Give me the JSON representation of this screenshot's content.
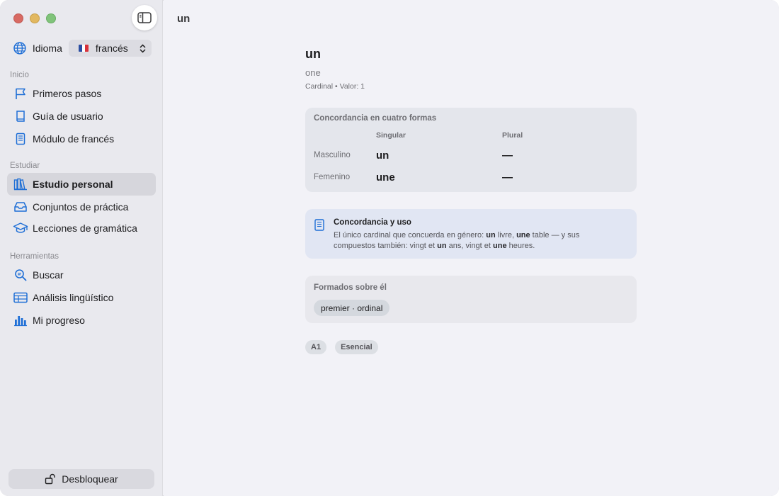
{
  "toolbar": {
    "title": "un"
  },
  "sidebar": {
    "language_label": "Idioma",
    "language_value": "francés",
    "sections": [
      {
        "title": "Inicio",
        "items": [
          {
            "label": "Primeros pasos",
            "icon": "flag-icon"
          },
          {
            "label": "Guía de usuario",
            "icon": "book-icon"
          },
          {
            "label": "Módulo de francés",
            "icon": "document-icon"
          }
        ]
      },
      {
        "title": "Estudiar",
        "items": [
          {
            "label": "Estudio personal",
            "icon": "books-icon",
            "active": true
          },
          {
            "label": "Conjuntos de práctica",
            "icon": "tray-icon"
          },
          {
            "label": "Lecciones de gramática",
            "icon": "graduation-cap-icon"
          }
        ]
      },
      {
        "title": "Herramientas",
        "items": [
          {
            "label": "Buscar",
            "icon": "search-icon"
          },
          {
            "label": "Análisis lingüístico",
            "icon": "table-icon"
          },
          {
            "label": "Mi progreso",
            "icon": "bar-chart-icon"
          }
        ]
      }
    ],
    "unlock_label": "Desbloquear"
  },
  "entry": {
    "word": "un",
    "translation": "one",
    "meta": "Cardinal • Valor: 1",
    "agreement": {
      "title": "Concordancia en cuatro formas",
      "columns": [
        "Singular",
        "Plural"
      ],
      "rows": [
        {
          "label": "Masculino",
          "singular": "un",
          "plural": "—"
        },
        {
          "label": "Femenino",
          "singular": "une",
          "plural": "—"
        }
      ]
    },
    "note": {
      "title": "Concordancia y uso",
      "body_parts": [
        {
          "t": "El único cardinal que concuerda en género: ",
          "b": false
        },
        {
          "t": "un",
          "b": true
        },
        {
          "t": " livre, ",
          "b": false
        },
        {
          "t": "une",
          "b": true
        },
        {
          "t": " table — y sus compuestos también: vingt et ",
          "b": false
        },
        {
          "t": "un",
          "b": true
        },
        {
          "t": " ans, vingt et ",
          "b": false
        },
        {
          "t": "une",
          "b": true
        },
        {
          "t": " heures.",
          "b": false
        }
      ]
    },
    "derived": {
      "title": "Formados sobre él",
      "chip": "premier · ordinal"
    },
    "tags": [
      "A1",
      "Esencial"
    ]
  },
  "colors": {
    "accent": "#1f6fd6",
    "sidebar_bg": "#e9e9ee",
    "note_bg": "#e1e6f3"
  }
}
